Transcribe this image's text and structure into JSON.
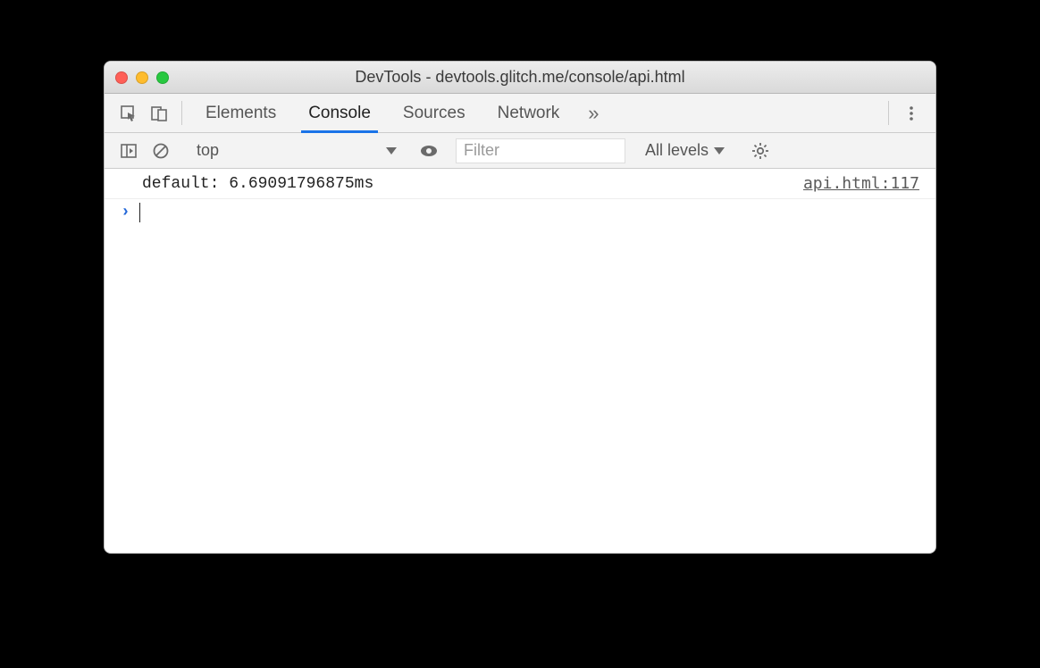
{
  "window": {
    "title": "DevTools - devtools.glitch.me/console/api.html"
  },
  "tabs": {
    "items": [
      "Elements",
      "Console",
      "Sources",
      "Network"
    ],
    "active_index": 1,
    "more_glyph": "»"
  },
  "toolbar": {
    "context": "top",
    "filter_placeholder": "Filter",
    "filter_value": "",
    "levels_label": "All levels"
  },
  "console": {
    "rows": [
      {
        "message": "default: 6.69091796875ms",
        "source": "api.html:117"
      }
    ],
    "prompt_glyph": "›"
  }
}
